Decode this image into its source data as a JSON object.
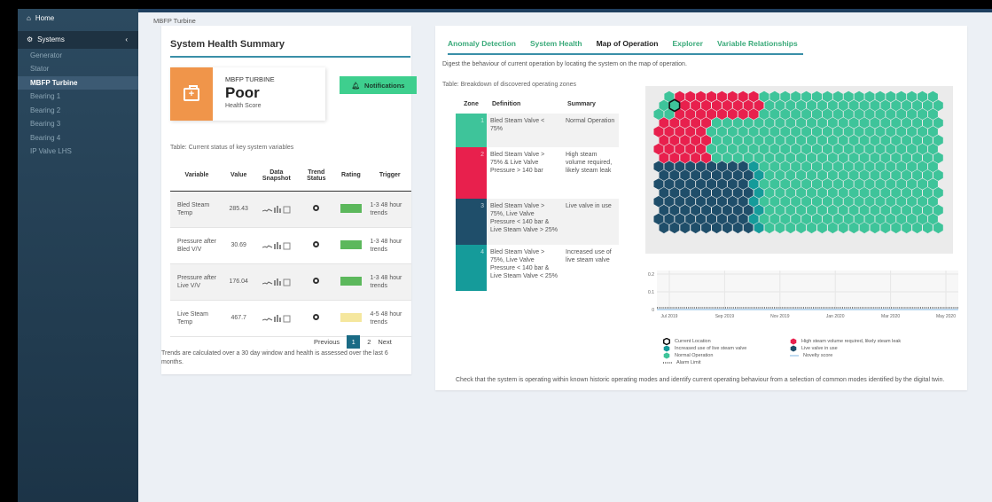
{
  "sidebar": {
    "home": "Home",
    "systems": "Systems",
    "items": [
      "Generator",
      "Stator",
      "MBFP Turbine",
      "Bearing 1",
      "Bearing 2",
      "Bearing 3",
      "Bearing 4",
      "IP Valve LHS"
    ],
    "active": "MBFP Turbine"
  },
  "breadcrumb": "MBFP Turbine",
  "health": {
    "title": "System Health Summary",
    "system_name": "MBFP TURBINE",
    "value": "Poor",
    "label": "Health Score",
    "notifications_label": "Notifications",
    "table_caption": "Table: Current status of key system variables",
    "columns": [
      "Variable",
      "Value",
      "Data Snapshot",
      "Trend Status",
      "Rating",
      "Trigger"
    ],
    "rows": [
      {
        "variable": "Bled Steam Temp",
        "value": "285.43",
        "rating_color": "#5cb85c",
        "trigger": "1-3 48 hour trends"
      },
      {
        "variable": "Pressure after Bled V/V",
        "value": "30.69",
        "rating_color": "#5cb85c",
        "trigger": "1-3 48 hour trends"
      },
      {
        "variable": "Pressure after Live V/V",
        "value": "176.04",
        "rating_color": "#5cb85c",
        "trigger": "1-3 48 hour trends"
      },
      {
        "variable": "Live Steam Temp",
        "value": "467.7",
        "rating_color": "#f5e79e",
        "trigger": "4-5 48 hour trends"
      }
    ],
    "pager": {
      "previous": "Previous",
      "page1": "1",
      "page2": "2",
      "next": "Next"
    },
    "footnote": "Trends are calculated over a 30 day window and health is assessed over the last 6 months."
  },
  "tabs": [
    "Anomaly Detection",
    "System Health",
    "Map of Operation",
    "Explorer",
    "Variable Relationships"
  ],
  "active_tab": "Map of Operation",
  "map": {
    "digest": "Digest the behaviour of current operation by locating the system on the map of operation.",
    "zone_caption": "Table: Breakdown of discovered operating zones",
    "zone_columns": [
      "Zone",
      "Definition",
      "Summary"
    ],
    "zones": [
      {
        "zone": "1",
        "color": "#3ec49a",
        "definition": "Bled Steam Valve < 75%",
        "summary": "Normal Operation"
      },
      {
        "zone": "2",
        "color": "#e8204d",
        "definition": "Bled Steam Valve > 75% & Live Valve Pressure > 140 bar",
        "summary": "High steam volume required, likely steam leak"
      },
      {
        "zone": "3",
        "color": "#1f4e6a",
        "definition": "Bled Steam Valve > 75%, Live Valve Pressure < 140 bar & Live Steam Valve > 25%",
        "summary": "Live valve in use"
      },
      {
        "zone": "4",
        "color": "#159b9a",
        "definition": "Bled Steam Valve > 75%, Live Valve Pressure < 140 bar & Live Steam Valve < 25%",
        "summary": "Increased use of live steam valve"
      }
    ],
    "hex_colors": {
      "normal": "#3ec49a",
      "leak": "#e8204d",
      "live": "#1f4e6a",
      "increased": "#159b9a",
      "background": "#ebebeb"
    },
    "legend": {
      "current": "Current Location",
      "increased": "Increased use of live steam valve",
      "normal": "Normal Operation",
      "alarm": "Alarm Limit",
      "leak": "High steam volume required, likely steam leak",
      "live": "Live valve in use",
      "novelty": "Novelty score"
    },
    "check_text": "Check that the system is operating within known historic operating modes and identify current operating behaviour from a selection of common modes identified by the digital twin."
  },
  "chart_data": {
    "type": "line",
    "x_ticks": [
      "Jul 2019",
      "Sep 2019",
      "Nov 2019",
      "Jan 2020",
      "Mar 2020",
      "May 2020"
    ],
    "y_ticks": [
      "0",
      "0.1",
      "0.2"
    ],
    "ylim": [
      0,
      0.2
    ],
    "series": [
      {
        "name": "Novelty score",
        "values": [
          0.0,
          0.0,
          0.0,
          0.0,
          0.0,
          0.0
        ]
      },
      {
        "name": "Alarm Limit",
        "values": [
          0.01,
          0.01,
          0.01,
          0.01,
          0.01,
          0.01
        ]
      }
    ]
  }
}
